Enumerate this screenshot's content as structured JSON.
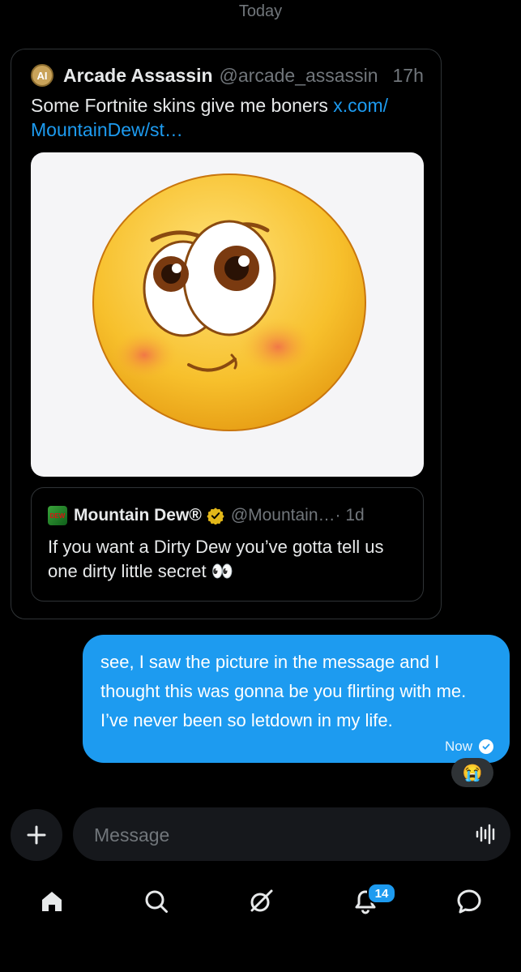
{
  "date_label": "Today",
  "tweet": {
    "avatar_text": "AI",
    "display_name": "Arcade Assassin",
    "handle": "@arcade_assassin",
    "time": "17h",
    "text": "Some Fortnite skins give me boners ",
    "link": "x.com/\nMountainDew/st…",
    "media_icon": "shy-emoji-image"
  },
  "quote": {
    "display_name": "Mountain Dew®",
    "handle": "@Mountain…",
    "time": "· 1d",
    "text": "If you want a Dirty Dew you’ve gotta tell us one dirty little secret 👀",
    "verified_color": "#e2b719"
  },
  "message": {
    "text": "see, I saw the picture in the message and I thought this was gonna be you flirting with me. I’ve never been so letdown in my life.",
    "status": "Now",
    "reaction": "😭"
  },
  "composer": {
    "placeholder": "Message"
  },
  "nav": {
    "notifications_badge": "14",
    "items": [
      "home-icon",
      "search-icon",
      "grok-icon",
      "notifications-icon",
      "messages-icon"
    ]
  },
  "colors": {
    "accent": "#1d9bf0",
    "background": "#000000",
    "muted": "#71767b"
  }
}
